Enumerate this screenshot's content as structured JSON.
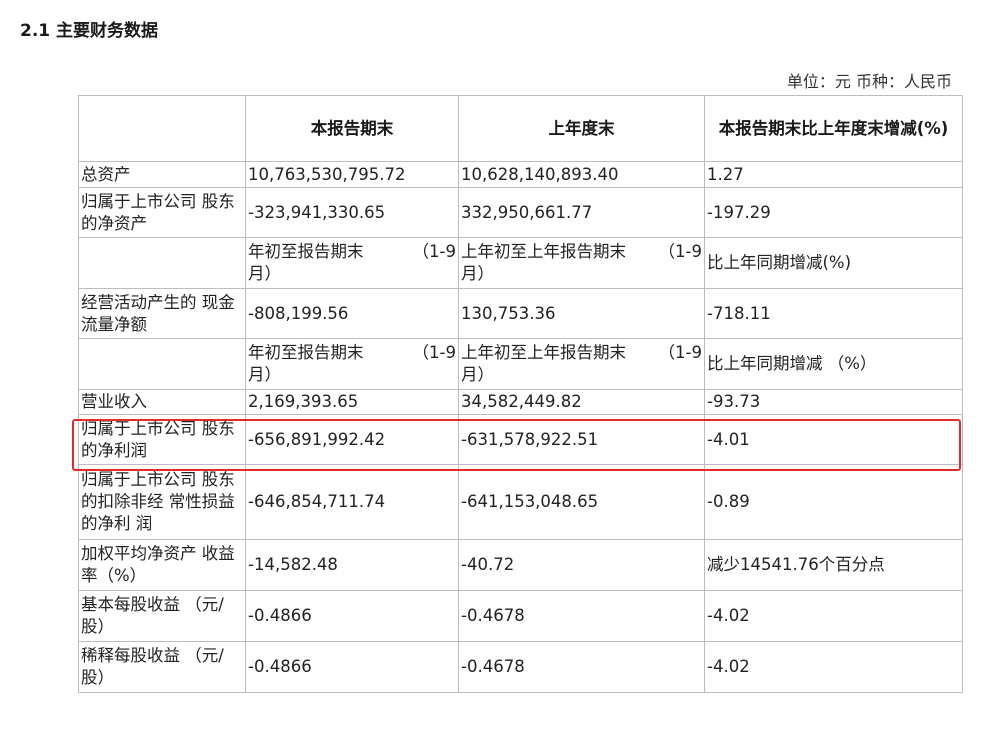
{
  "section_title": "2.1 主要财务数据",
  "unit_line": "单位：元 币种：人民币",
  "header": {
    "col1": "本报告期末",
    "col2": "上年度末",
    "col3": "本报告期末比上年度末增减(%)"
  },
  "rows": [
    {
      "label": "总资产",
      "c1": "10,763,530,795.72",
      "c2": "10,628,140,893.40",
      "c3": "1.27"
    },
    {
      "label": "归属于上市公司 股东的净资产",
      "c1": "-323,941,330.65",
      "c2": "332,950,661.77",
      "c3": "-197.29"
    },
    {
      "sub_c1_a": "年初至报告期末",
      "sub_c1_b": "（1-9",
      "sub_c1_c": "月）",
      "sub_c2_a": "上年初至上年报告期末",
      "sub_c2_b": "（1-9",
      "sub_c2_c": "月）",
      "sub_c3": "比上年同期增减(%)"
    },
    {
      "label": "经营活动产生的 现金流量净额",
      "c1": "-808,199.56",
      "c2": "130,753.36",
      "c3": "-718.11"
    },
    {
      "sub_c1_a": "年初至报告期末",
      "sub_c1_b": "（1-9",
      "sub_c1_c": "月）",
      "sub_c2_a": "上年初至上年报告期末",
      "sub_c2_b": "（1-9",
      "sub_c2_c": "月）",
      "sub_c3": "比上年同期增减 （%）"
    },
    {
      "label": "营业收入",
      "c1": "2,169,393.65",
      "c2": "34,582,449.82",
      "c3": "-93.73"
    },
    {
      "label": "归属于上市公司 股东的净利润",
      "c1": "-656,891,992.42",
      "c2": "-631,578,922.51",
      "c3": "-4.01"
    },
    {
      "label": "归属于上市公司 股东的扣除非经 常性损益的净利 润",
      "c1": "-646,854,711.74",
      "c2": "-641,153,048.65",
      "c3": "-0.89"
    },
    {
      "label": "加权平均净资产 收益率（%）",
      "c1": "-14,582.48",
      "c2": "-40.72",
      "c3": "减少14541.76个百分点"
    },
    {
      "label": "基本每股收益 （元/股）",
      "c1": "-0.4866",
      "c2": "-0.4678",
      "c3": "-4.02"
    },
    {
      "label": "稀释每股收益 （元/股）",
      "c1": "-0.4866",
      "c2": "-0.4678",
      "c3": "-4.02"
    }
  ],
  "highlight_color": "#e32b2b"
}
